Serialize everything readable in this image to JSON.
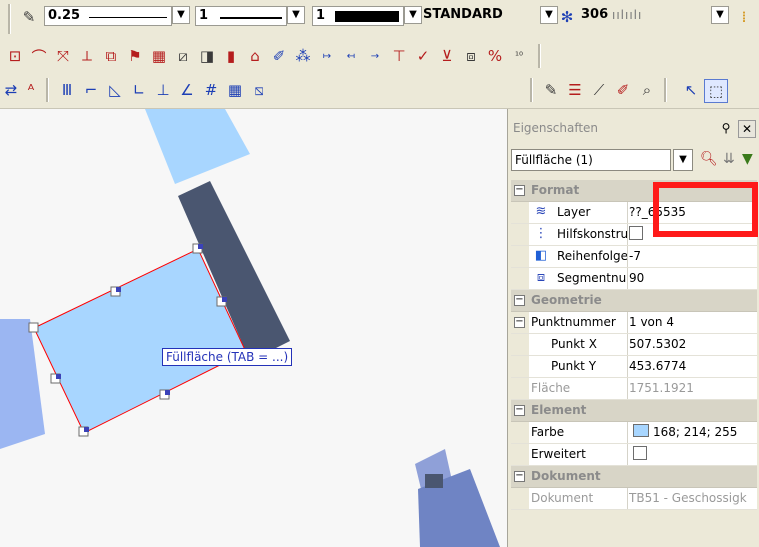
{
  "toolbar1": {
    "line_width": "0.25",
    "line_type": "1",
    "color_index": "1",
    "text_style": "STANDARD",
    "pattern_value": "306"
  },
  "toolbar2": {
    "icons": [
      "rect-tool-icon",
      "arc-tool-icon",
      "dimension-icon",
      "measure-icon",
      "layer-icon",
      "flag-icon",
      "grid-icon",
      "frame-icon",
      "fill-icon",
      "palette-icon",
      "stamp-icon",
      "text-edit-icon",
      "pattern-icon",
      "arrow-right-icon",
      "arrow-cross-icon",
      "number-icon",
      "align-icon",
      "tick-icon",
      "stamp-x-icon",
      "counter-icon",
      "percent-icon",
      "sup-icon"
    ]
  },
  "toolbar3": {
    "icons": [
      "snap-icon",
      "text-a-icon",
      "hatch-icon",
      "corner-icon",
      "triangle-icon",
      "angle-icon",
      "perpendicular-icon",
      "tangent-icon",
      "grid-hash-icon",
      "matrix-icon",
      "ratio-icon",
      "pen-icon",
      "list-icon",
      "layers-icon",
      "brush-icon",
      "magnify-icon",
      "select-arrow-icon",
      "select-frame-icon"
    ]
  },
  "canvas": {
    "tooltip": "Füllfläche (TAB = ...)",
    "colors": {
      "fill": "#A8D6FF",
      "dark": "#4A5670",
      "selection": "#ff0000"
    }
  },
  "panel": {
    "title": "Eigenschaften",
    "selection": "Füllfläche (1)",
    "categories": [
      {
        "name": "Format",
        "rows": [
          {
            "label": "Layer",
            "value": "??_65535",
            "icon": "layer-icon"
          },
          {
            "label": "Hilfskonstru",
            "value": "",
            "icon": "helper-icon",
            "checkbox": true
          },
          {
            "label": "Reihenfolge",
            "value": "-7",
            "icon": "order-icon"
          },
          {
            "label": "Segmentnur",
            "value": "90",
            "icon": "segment-icon"
          }
        ]
      },
      {
        "name": "Geometrie",
        "rows": [
          {
            "label": "Punktnummer",
            "value": "1 von 4",
            "collapsible": true
          },
          {
            "label": "Punkt X",
            "value": "507.5302"
          },
          {
            "label": "Punkt Y",
            "value": "453.6774"
          },
          {
            "label": "Fläche",
            "value": "1751.1921",
            "dim": true
          }
        ]
      },
      {
        "name": "Element",
        "rows": [
          {
            "label": "Farbe",
            "value": "168; 214; 255",
            "swatch": "#A8D6FF"
          },
          {
            "label": "Erweitert",
            "value": "",
            "checkbox": true
          }
        ]
      },
      {
        "name": "Dokument",
        "rows": [
          {
            "label": "Dokument",
            "value": "TB51 - Geschossigk",
            "dim": true
          }
        ]
      }
    ]
  }
}
